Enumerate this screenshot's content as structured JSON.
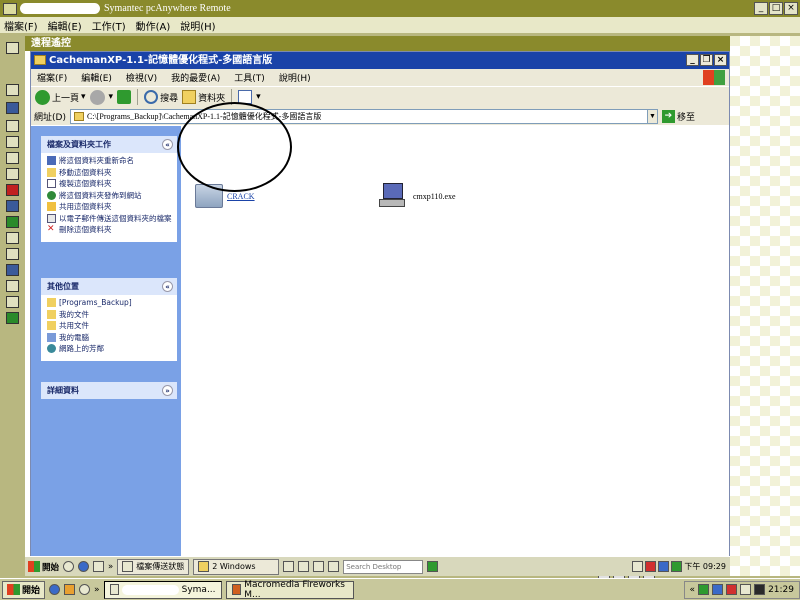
{
  "outer": {
    "title": "Symantec pcAnywhere Remote",
    "menu": [
      "檔案(F)",
      "編輯(E)",
      "工作(T)",
      "動作(A)",
      "說明(H)"
    ],
    "minimize": "_",
    "maximize": "□",
    "close": "×"
  },
  "remote_header": "遠程遙控",
  "explorer": {
    "title": "CachemanXP-1.1-記憶體優化程式-多國語言版",
    "minimize": "_",
    "restore": "❐",
    "close": "×",
    "menu": [
      "檔案(F)",
      "編輯(E)",
      "檢視(V)",
      "我的最愛(A)",
      "工具(T)",
      "說明(H)"
    ],
    "toolbar": {
      "back": "上一頁",
      "search": "搜尋",
      "folders": "資料夾"
    },
    "address_label": "網址(D)",
    "address_value": "C:\\[Programs_Backup]\\CachemanXP-1.1-記憶體優化程式-多國語言版",
    "go_label": "移至",
    "tasks_panel": {
      "title": "檔案及資料夾工作",
      "collapse": "«",
      "items": [
        "將這個資料夾重新命名",
        "移動這個資料夾",
        "複製這個資料夾",
        "將這個資料夾發佈到網站",
        "共用這個資料夾",
        "以電子郵件傳送這個資料夾的檔案",
        "刪除這個資料夾"
      ]
    },
    "places_panel": {
      "title": "其他位置",
      "collapse": "«",
      "items": [
        "[Programs_Backup]",
        "我的文件",
        "共用文件",
        "我的電腦",
        "網路上的芳鄰"
      ]
    },
    "details_panel": {
      "title": "詳細資料",
      "expand": "»"
    },
    "files": [
      {
        "name": "CRACK",
        "selected": true
      },
      {
        "name": "cmxp110.exe",
        "selected": false
      }
    ]
  },
  "remote_taskbar": {
    "start": "開始",
    "task_transfer": "檔案傳送狀態",
    "task_windows": "2 Windows",
    "search_placeholder": "Search Desktop",
    "time": "下午 09:29"
  },
  "local_taskbar": {
    "start": "開始",
    "task_syma": "Syma...",
    "task_fireworks": "Macromedia Fireworks M...",
    "time": "21:29"
  },
  "colors": {
    "xp_blue": "#1a43a8",
    "taskpane_blue": "#7aa1e6",
    "olive": "#8a8a2c"
  }
}
